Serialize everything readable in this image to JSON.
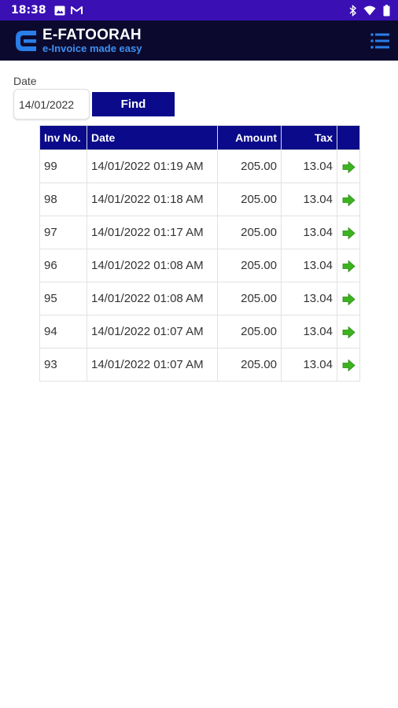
{
  "status_bar": {
    "time": "18:38",
    "left_icons": [
      "photo-icon",
      "gmail-icon"
    ],
    "right_icons": [
      "bluetooth-icon",
      "wifi-icon",
      "battery-icon"
    ]
  },
  "app_bar": {
    "brand_name": "E-FATOORAH",
    "tagline": "e-Invoice made easy",
    "menu_icon": "menu-icon",
    "accent_color": "#3f8ff0",
    "background_color": "#0b0a2e"
  },
  "search": {
    "date_label": "Date",
    "date_value": "14/01/2022",
    "find_label": "Find"
  },
  "table": {
    "headers": {
      "inv_no": "Inv No.",
      "date": "Date",
      "amount": "Amount",
      "tax": "Tax",
      "action": ""
    },
    "header_color": "#0a0a8a",
    "rows": [
      {
        "inv_no": "99",
        "date": "14/01/2022 01:19 AM",
        "amount": "205.00",
        "tax": "13.04"
      },
      {
        "inv_no": "98",
        "date": "14/01/2022 01:18 AM",
        "amount": "205.00",
        "tax": "13.04"
      },
      {
        "inv_no": "97",
        "date": "14/01/2022 01:17 AM",
        "amount": "205.00",
        "tax": "13.04"
      },
      {
        "inv_no": "96",
        "date": "14/01/2022 01:08 AM",
        "amount": "205.00",
        "tax": "13.04"
      },
      {
        "inv_no": "95",
        "date": "14/01/2022 01:08 AM",
        "amount": "205.00",
        "tax": "13.04"
      },
      {
        "inv_no": "94",
        "date": "14/01/2022 01:07 AM",
        "amount": "205.00",
        "tax": "13.04"
      },
      {
        "inv_no": "93",
        "date": "14/01/2022 01:07 AM",
        "amount": "205.00",
        "tax": "13.04"
      }
    ],
    "row_action_icon": "arrow-right-icon",
    "row_action_color": "#3cb31f"
  }
}
